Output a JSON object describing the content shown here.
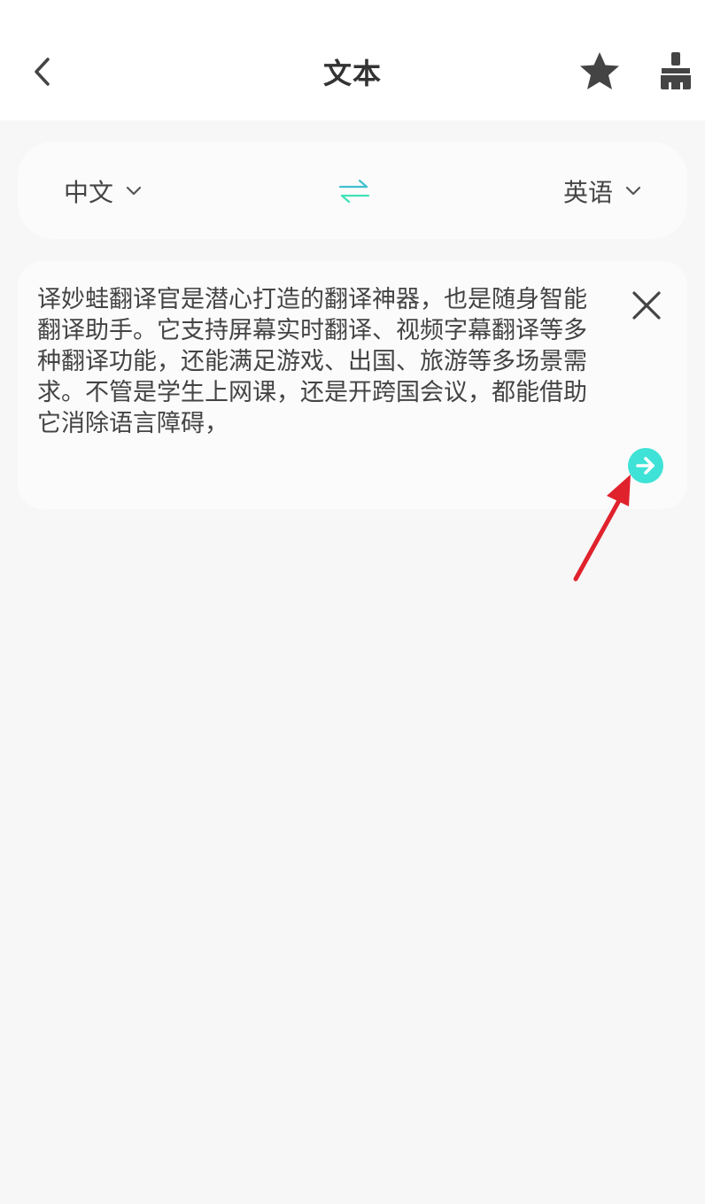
{
  "header": {
    "title": "文本",
    "back_icon": "chevron-left-icon",
    "favorite_icon": "star-icon",
    "clean_icon": "brush-icon"
  },
  "language_bar": {
    "source_language": "中文",
    "target_language": "英语",
    "swap_icon": "swap-arrows-icon",
    "accent_color": "#3fe2d6"
  },
  "input": {
    "text": "译妙蛙翻译官是潜心打造的翻译神器，也是随身智能翻译助手。它支持屏幕实时翻译、视频字幕翻译等多种翻译功能，还能满足游戏、出国、旅游等多场景需求。不管是学生上网课，还是开跨国会议，都能借助它消除语言障碍，",
    "clear_icon": "close-icon",
    "translate_icon": "arrow-right-circle-icon"
  },
  "annotation": {
    "color": "#e0222d"
  }
}
